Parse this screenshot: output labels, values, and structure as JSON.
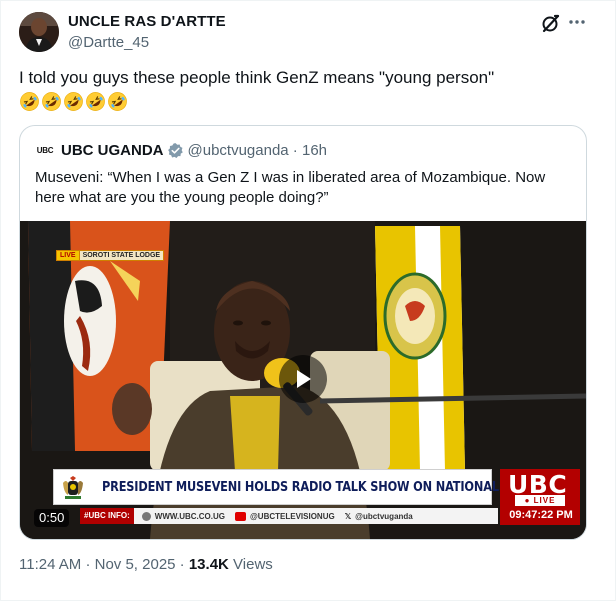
{
  "author": {
    "name": "UNCLE RAS D'ARTTE",
    "handle": "@Dartte_45"
  },
  "tweet": {
    "text": "I told you guys these people think GenZ means \"young person\"",
    "emojis": [
      "rolling-on-floor-laughing-emoji",
      "rolling-on-floor-laughing-emoji",
      "rolling-on-floor-laughing-emoji",
      "rolling-on-floor-laughing-emoji",
      "rolling-on-floor-laughing-emoji"
    ]
  },
  "quote": {
    "logo_text": "UBC",
    "name": "UBC UGANDA",
    "handle": "@ubctvuganda",
    "time": "16h",
    "text": "Museveni: “When I was a Gen Z I was in liberated area of Mozambique. Now here what are you the young people doing?”"
  },
  "video": {
    "duration": "0:50",
    "live_tag": "LIVE",
    "location_tag": "SOROTI STATE LODGE",
    "headline": "PRESIDENT MUSEVENI HOLDS RADIO TALK SHOW ON NATIONAL ISSUES",
    "channel_logo": "UBC",
    "live_badge": "● LIVE",
    "clock": "09:47:22 PM",
    "ticker_label": "#UBC INFO:",
    "ticker_items": [
      "WWW.UBC.CO.UG",
      "@UBCTELEVISIONUG",
      "@ubctvuganda"
    ]
  },
  "footer": {
    "time": "11:24 AM",
    "date": "Nov 5, 2025",
    "views_count": "13.4K",
    "views_label": "Views"
  },
  "colors": {
    "text_primary": "#0f1419",
    "text_secondary": "#536471",
    "verified_badge": "#829aab",
    "ubc_red": "#b30000",
    "headline_navy": "#0e1d5a"
  }
}
